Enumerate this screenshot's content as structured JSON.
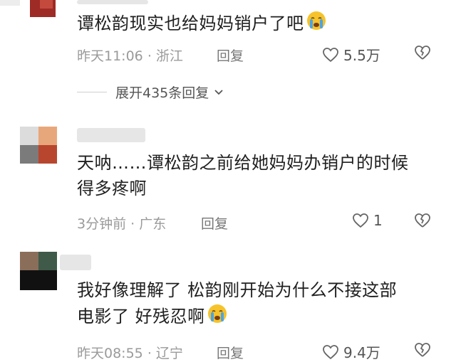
{
  "comments": [
    {
      "text": "谭松韵现实也给妈妈销户了吧",
      "emoji": "crying-face-emoji",
      "time": "昨天11:06",
      "location": "浙江",
      "reply_label": "回复",
      "likes": "5.5万",
      "expand_label": "展开435条回复"
    },
    {
      "text_line1": "天呐……谭松韵之前给她妈妈办销户的时候",
      "text_line2": "得多疼啊",
      "time": "3分钟前",
      "location": "广东",
      "reply_label": "回复",
      "likes": "1"
    },
    {
      "text_line1": "我好像理解了 松韵刚开始为什么不接这部",
      "text_line2": "电影了 好残忍啊",
      "emoji": "crying-face-emoji",
      "time": "昨天08:55",
      "location": "辽宁",
      "reply_label": "回复",
      "likes": "9.4万"
    }
  ],
  "separator": "·",
  "colors": {
    "text": "#1f1f1f",
    "meta": "#9a9a9a",
    "icon": "#666666",
    "avatar_red": "#b03a2e"
  }
}
